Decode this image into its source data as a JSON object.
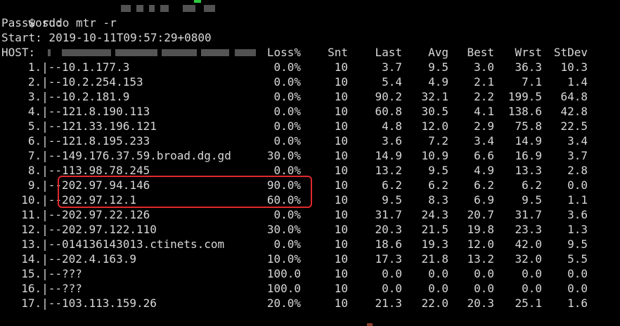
{
  "terminal": {
    "command": "$ sudo mtr -r",
    "password_prompt": "Password:",
    "start_line": "Start: 2019-10-11T09:57:29+0800",
    "host_label": "HOST:",
    "headers": {
      "loss": "Loss%",
      "snt": "Snt",
      "last": "Last",
      "avg": "Avg",
      "best": "Best",
      "wrst": "Wrst",
      "stdev": "StDev"
    },
    "hops": [
      {
        "hop": "1.|--",
        "host": "10.1.177.3",
        "loss": "0.0%",
        "snt": "10",
        "last": "3.7",
        "avg": "9.5",
        "best": "3.0",
        "wrst": "36.3",
        "stdev": "10.3"
      },
      {
        "hop": "2.|--",
        "host": "10.2.254.153",
        "loss": "0.0%",
        "snt": "10",
        "last": "5.4",
        "avg": "4.9",
        "best": "2.1",
        "wrst": "7.1",
        "stdev": "1.4"
      },
      {
        "hop": "3.|--",
        "host": "10.2.181.9",
        "loss": "0.0%",
        "snt": "10",
        "last": "90.2",
        "avg": "32.1",
        "best": "2.2",
        "wrst": "199.5",
        "stdev": "64.8"
      },
      {
        "hop": "4.|--",
        "host": "121.8.190.113",
        "loss": "0.0%",
        "snt": "10",
        "last": "60.8",
        "avg": "30.5",
        "best": "4.1",
        "wrst": "138.6",
        "stdev": "42.8"
      },
      {
        "hop": "5.|--",
        "host": "121.33.196.121",
        "loss": "0.0%",
        "snt": "10",
        "last": "4.8",
        "avg": "12.0",
        "best": "2.9",
        "wrst": "75.8",
        "stdev": "22.5"
      },
      {
        "hop": "6.|--",
        "host": "121.8.195.233",
        "loss": "0.0%",
        "snt": "10",
        "last": "3.6",
        "avg": "7.2",
        "best": "3.4",
        "wrst": "14.9",
        "stdev": "3.4"
      },
      {
        "hop": "7.|--",
        "host": "149.176.37.59.broad.dg.gd",
        "loss": "30.0%",
        "snt": "10",
        "last": "14.9",
        "avg": "10.9",
        "best": "6.6",
        "wrst": "16.9",
        "stdev": "3.7"
      },
      {
        "hop": "8.|--",
        "host": "113.98.78.245",
        "loss": "0.0%",
        "snt": "10",
        "last": "13.2",
        "avg": "9.5",
        "best": "4.9",
        "wrst": "13.3",
        "stdev": "2.8"
      },
      {
        "hop": "9.|--",
        "host": "202.97.94.146",
        "loss": "90.0%",
        "snt": "10",
        "last": "6.2",
        "avg": "6.2",
        "best": "6.2",
        "wrst": "6.2",
        "stdev": "0.0"
      },
      {
        "hop": "10.|--",
        "host": "202.97.12.1",
        "loss": "60.0%",
        "snt": "10",
        "last": "9.5",
        "avg": "8.3",
        "best": "6.9",
        "wrst": "9.5",
        "stdev": "1.1"
      },
      {
        "hop": "11.|--",
        "host": "202.97.22.126",
        "loss": "0.0%",
        "snt": "10",
        "last": "31.7",
        "avg": "24.3",
        "best": "20.7",
        "wrst": "31.7",
        "stdev": "3.6"
      },
      {
        "hop": "12.|--",
        "host": "202.97.122.110",
        "loss": "30.0%",
        "snt": "10",
        "last": "20.3",
        "avg": "21.5",
        "best": "19.8",
        "wrst": "23.3",
        "stdev": "1.3"
      },
      {
        "hop": "13.|--",
        "host": "014136143013.ctinets.com",
        "loss": "0.0%",
        "snt": "10",
        "last": "18.6",
        "avg": "19.3",
        "best": "12.0",
        "wrst": "42.0",
        "stdev": "9.5"
      },
      {
        "hop": "14.|--",
        "host": "202.4.163.9",
        "loss": "10.0%",
        "snt": "10",
        "last": "17.3",
        "avg": "21.8",
        "best": "13.2",
        "wrst": "32.0",
        "stdev": "5.5"
      },
      {
        "hop": "15.|--",
        "host": "???",
        "loss": "100.0",
        "snt": "10",
        "last": "0.0",
        "avg": "0.0",
        "best": "0.0",
        "wrst": "0.0",
        "stdev": "0.0"
      },
      {
        "hop": "16.|--",
        "host": "???",
        "loss": "100.0",
        "snt": "10",
        "last": "0.0",
        "avg": "0.0",
        "best": "0.0",
        "wrst": "0.0",
        "stdev": "0.0"
      },
      {
        "hop": "17.|--",
        "host": "103.113.159.26",
        "loss": "20.0%",
        "snt": "10",
        "last": "21.3",
        "avg": "22.0",
        "best": "20.3",
        "wrst": "25.1",
        "stdev": "1.6"
      }
    ]
  },
  "colors": {
    "background": "#000000",
    "text": "#d8d8d8",
    "highlight": "#e0282e"
  }
}
